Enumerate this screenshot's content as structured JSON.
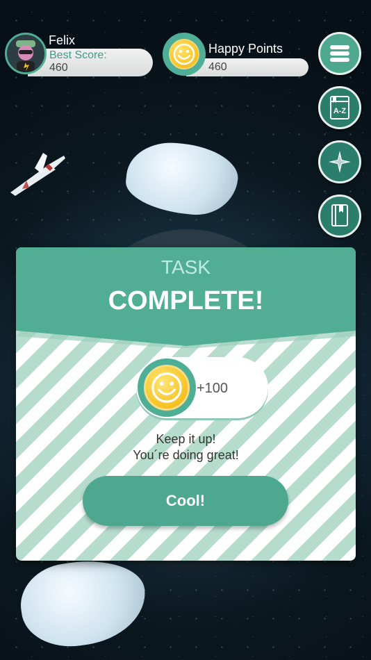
{
  "player": {
    "name": "Felix",
    "best_score_label": "Best Score:",
    "best_score": "460"
  },
  "happy_points": {
    "label": "Happy Points",
    "value": "460"
  },
  "side_menu": {
    "icons": [
      "menu-icon",
      "dictionary-az-icon",
      "compass-icon",
      "book-icon"
    ],
    "dictionary_text": "A-Z"
  },
  "modal": {
    "title_top": "TASK",
    "title_main": "COMPLETE!",
    "reward_amount": "+100",
    "message_line1": "Keep it up!",
    "message_line2": "You´re doing great!",
    "button_label": "Cool!"
  },
  "colors": {
    "accent": "#4ea890",
    "coin": "#f6c222"
  }
}
